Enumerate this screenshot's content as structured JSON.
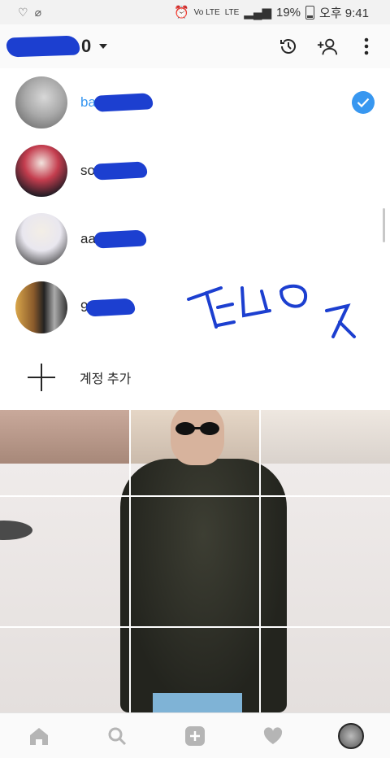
{
  "status_bar": {
    "battery": "19%",
    "time": "오후 9:41",
    "network": "LTE",
    "carrier_small": "Vo LTE"
  },
  "header": {
    "username_visible_suffix": "0"
  },
  "accounts": [
    {
      "visible_prefix": "ba",
      "active": true
    },
    {
      "visible_prefix": "so",
      "active": false
    },
    {
      "visible_prefix": "aa",
      "active": false
    },
    {
      "visible_prefix": "9",
      "active": false
    }
  ],
  "add_account": {
    "label": "계정 추가"
  },
  "annotation": {
    "color": "#1c3fd0"
  },
  "bottom_nav": [
    "home-icon",
    "search-icon",
    "add-post-icon",
    "activity-heart-icon",
    "profile-avatar"
  ],
  "colors": {
    "accent_blue": "#3897f0",
    "redaction_blue": "#1c3fd0"
  }
}
